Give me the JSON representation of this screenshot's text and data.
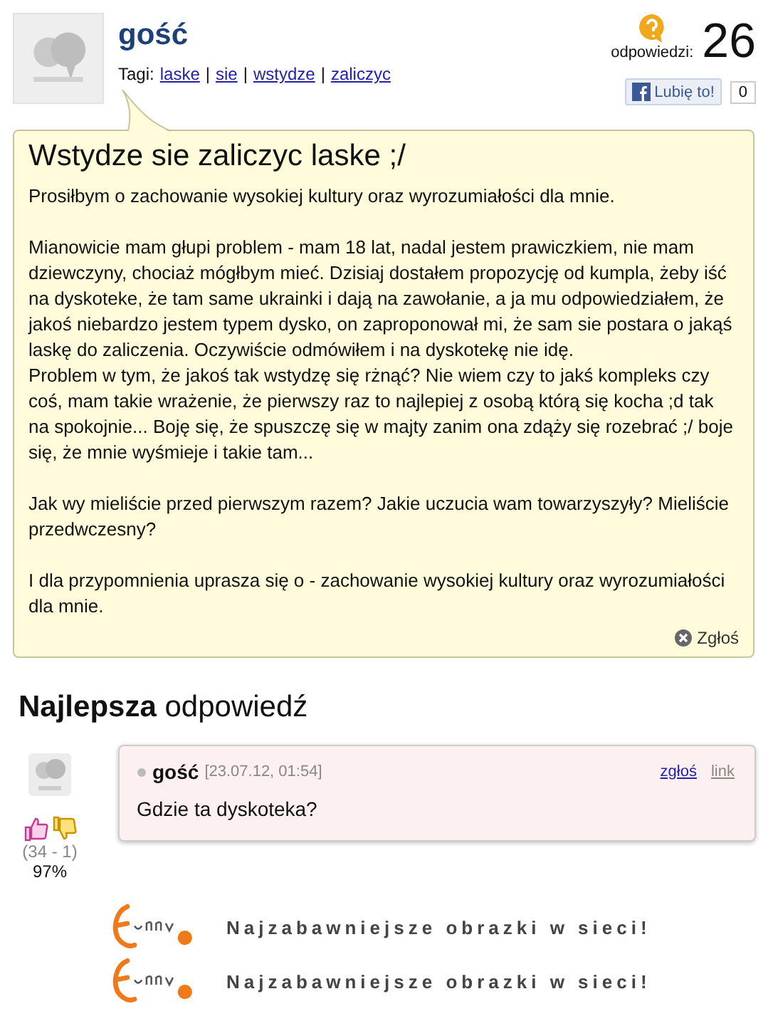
{
  "question": {
    "author": "gość",
    "tags_label": "Tagi:",
    "tags": [
      "laske",
      "sie",
      "wstydze",
      "zaliczyc"
    ],
    "tag_separator": "|",
    "answers_label": "odpowiedzi:",
    "answers_count": "26",
    "like_label": "Lubię to!",
    "like_count": "0",
    "title": "Wstydze sie zaliczyc laske ;/",
    "body": [
      [
        "Prosiłbym o zachowanie wysokiej kultury oraz wyrozumiałości dla mnie."
      ],
      [
        "Mianowicie mam głupi problem - mam 18 lat, nadal jestem prawiczkiem, nie mam dziewczyny, chociaż mógłbym mieć. Dzisiaj dostałem propozycję od kumpla, żeby iść na dyskoteke, że tam same ukrainki i dają na zawołanie, a ja mu odpowiedziałem, że jakoś niebardzo jestem typem dysko, on zaproponował mi, że sam sie postara o jakąś laskę do zaliczenia. Oczywiście odmówiłem i na dyskotekę nie idę.",
        "Problem w tym, że jakoś tak wstydzę się rżnąć? Nie wiem czy to jakś kompleks czy coś, mam takie wrażenie, że pierwszy raz to najlepiej z osobą którą się kocha ;d tak na spokojnie... Boję się, że spuszczę się w majty zanim ona zdąży się rozebrać ;/ boje się, że mnie wyśmieje i takie tam..."
      ],
      [
        "Jak wy mieliście przed pierwszym razem? Jakie uczucia wam towarzyszyły? Mieliście przedwczesny?"
      ],
      [
        "I dla przypomnienia uprasza się o - zachowanie wysokiej kultury oraz wyrozumiałości dla mnie."
      ]
    ],
    "report_label": "Zgłoś"
  },
  "best_answer": {
    "heading_bold": "Najlepsza",
    "heading_rest": "odpowiedź",
    "author": "gość",
    "date": "[23.07.12, 01:54]",
    "report_link": "zgłoś",
    "link_label": "link",
    "text": "Gdzie ta dyskoteka?",
    "votes": "(34 - 1)",
    "percent": "97%"
  },
  "ads": [
    {
      "text": "Najzabawniejsze obrazki w sieci!"
    },
    {
      "text": "Najzabawniejsze obrazki w sieci!"
    }
  ]
}
